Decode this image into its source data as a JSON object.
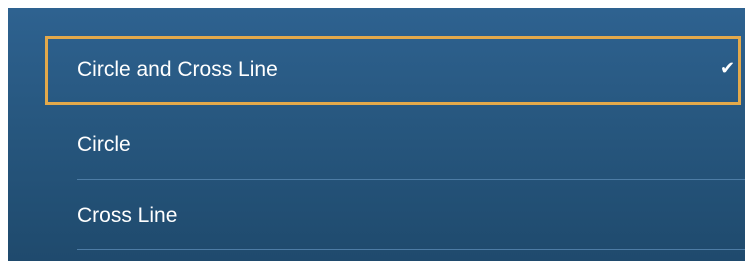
{
  "menu": {
    "selected_index": 0,
    "items": [
      {
        "label": "Circle and Cross Line",
        "checkmark": "✔"
      },
      {
        "label": "Circle"
      },
      {
        "label": "Cross Line"
      }
    ]
  },
  "colors": {
    "panel_top": "#2e6290",
    "panel_bottom": "#1f4a6d",
    "selection_border": "#e3a94b",
    "divider": "#4d7ca5",
    "text": "#ffffff"
  },
  "icons": {
    "selected_marker": "checkmark-icon"
  }
}
